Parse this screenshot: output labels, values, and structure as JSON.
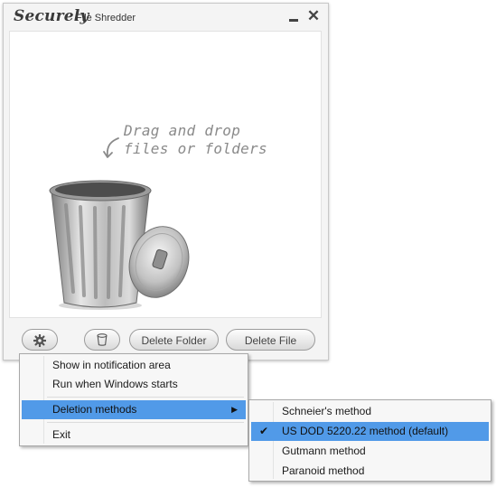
{
  "window": {
    "brand": "Securely",
    "title": "File Shredder"
  },
  "drop_area": {
    "hint_line1": "Drag and drop",
    "hint_line2": "files or folders"
  },
  "toolbar": {
    "settings_icon": "gear-icon",
    "trash_icon": "trash-icon",
    "delete_folder_label": "Delete Folder",
    "delete_file_label": "Delete File"
  },
  "context_menu": {
    "items": [
      {
        "label": "Show in notification area"
      },
      {
        "label": "Run when Windows starts"
      },
      {
        "label": "Deletion methods",
        "has_submenu": true,
        "selected": true
      },
      {
        "label": "Exit"
      }
    ]
  },
  "submenu": {
    "items": [
      {
        "label": "Schneier's method",
        "checked": false
      },
      {
        "label": "US DOD 5220.22 method (default)",
        "checked": true,
        "selected": true
      },
      {
        "label": "Gutmann method",
        "checked": false
      },
      {
        "label": "Paranoid method",
        "checked": false
      }
    ]
  },
  "colors": {
    "menu_highlight": "#519ae8",
    "window_bg": "#f4f4f4"
  }
}
